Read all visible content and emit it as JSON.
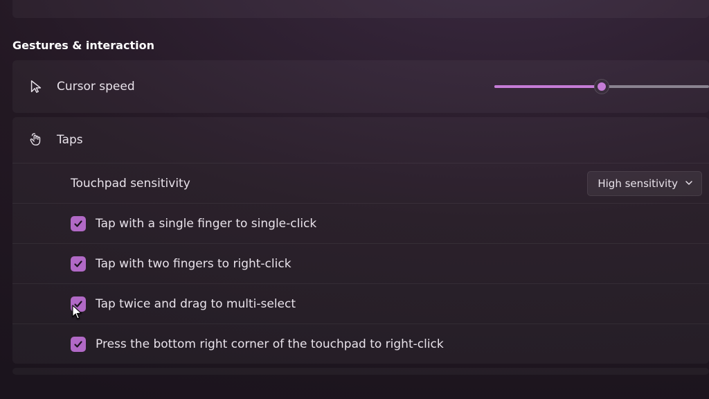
{
  "section": {
    "title": "Gestures & interaction"
  },
  "cursor_speed": {
    "label": "Cursor speed",
    "value_percent": 50
  },
  "taps": {
    "label": "Taps",
    "sensitivity": {
      "label": "Touchpad sensitivity",
      "selected": "High sensitivity"
    },
    "options": [
      {
        "label": "Tap with a single finger to single-click",
        "checked": true
      },
      {
        "label": "Tap with two fingers to right-click",
        "checked": true
      },
      {
        "label": "Tap twice and drag to multi-select",
        "checked": true
      },
      {
        "label": "Press the bottom right corner of the touchpad to right-click",
        "checked": true
      }
    ]
  },
  "colors": {
    "accent": "#c57cd6"
  }
}
